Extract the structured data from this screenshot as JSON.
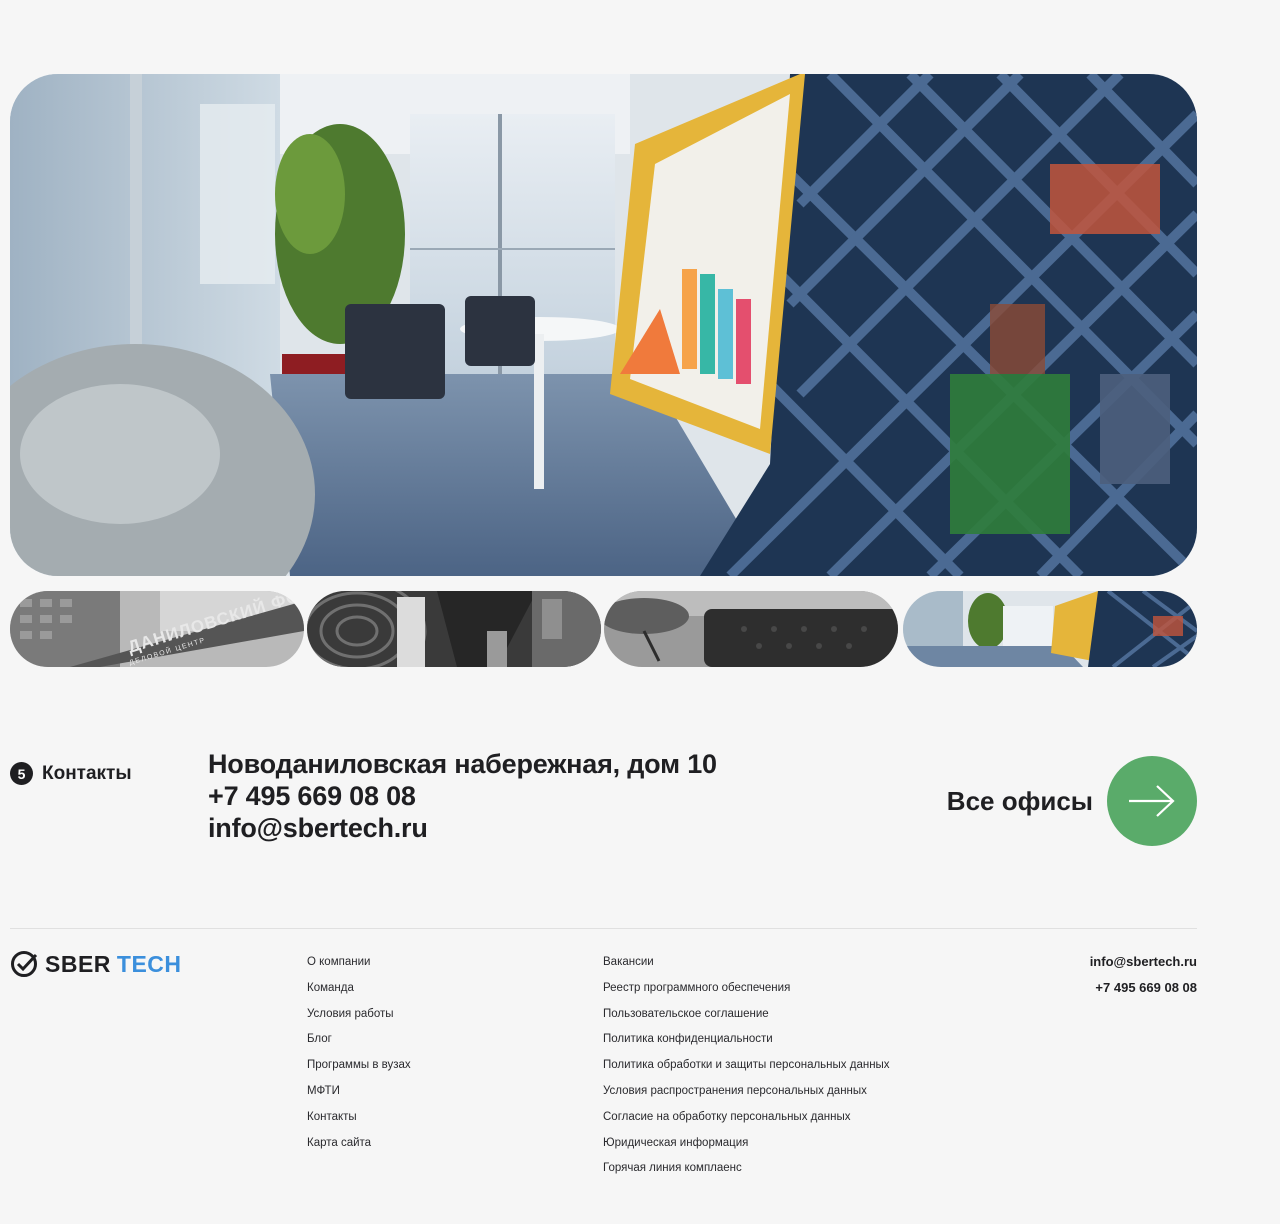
{
  "gallery": {
    "main_image": "office-library-lounge-photo",
    "thumbnails": [
      {
        "image": "business-center-entrance-photo",
        "label": "ДАНИЛОВСКИЙ ФОРТ",
        "sublabel": "ДЕЛОВОЙ ЦЕНТР"
      },
      {
        "image": "office-corridor-photo"
      },
      {
        "image": "lounge-sofa-photo"
      },
      {
        "image": "office-library-lounge-photo"
      }
    ],
    "active_index": 3
  },
  "contacts": {
    "number": "5",
    "label": "Контакты",
    "address": "Новоданиловская набережная, дом 10",
    "phone": "+7 495 669 08 08",
    "email": "info@sbertech.ru",
    "all_offices_label": "Все офисы",
    "all_offices_icon": "arrow-right-icon",
    "accent_color": "#5aab6a"
  },
  "footer": {
    "logo": {
      "part1": "SBER",
      "part2": "TECH",
      "accent_color": "#3b8fdc"
    },
    "col1": [
      "О компании",
      "Команда",
      "Условия работы",
      "Блог",
      "Программы в вузах",
      "МФТИ",
      "Контакты",
      "Карта сайта"
    ],
    "col2": [
      "Вакансии",
      "Реестр программного обеспечения",
      "Пользовательское соглашение",
      "Политика конфиденциальности",
      "Политика обработки и защиты персональных данных",
      "Условия распространения персональных данных",
      "Согласие на обработку персональных данных",
      "Юридическая информация",
      "Горячая линия комплаенс"
    ],
    "email": "info@sbertech.ru",
    "phone": "+7 495 669 08 08"
  }
}
